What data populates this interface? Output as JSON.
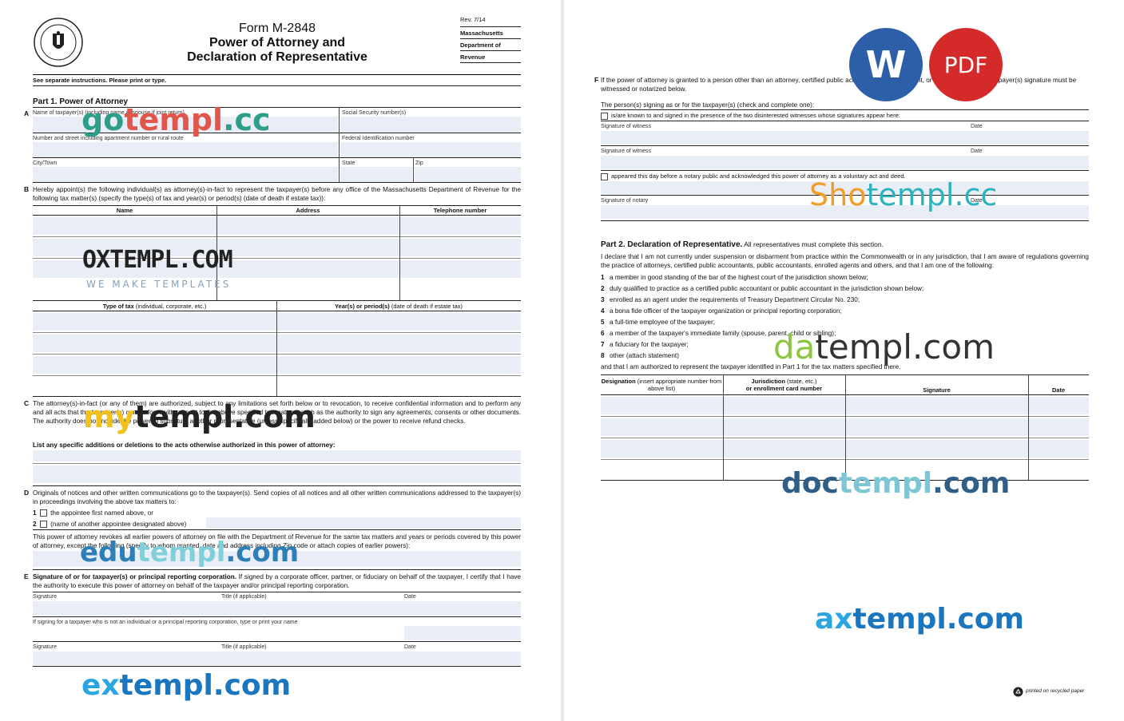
{
  "form": {
    "title_line1": "Form M-2848",
    "title_line2": "Power of Attorney and",
    "title_line3": "Declaration of Representative",
    "rev": "Rev. 7/14",
    "agency1": "Massachusetts",
    "agency2": "Department of",
    "agency3": "Revenue",
    "instructions": "See separate instructions. Please print or type.",
    "seal_text": "MASSACHUSETTS DEPARTMENT OF REVENUE"
  },
  "part1": {
    "title": "Part 1. Power of Attorney",
    "A": {
      "letter": "A",
      "name_label": "Name of taxpayer(s) (including name of spouse if joint return)",
      "ssn_label": "Social Security number(s)",
      "street_label": "Number and street including apartment number or rural route",
      "fid_label": "Federal Identification number",
      "city_label": "City/Town",
      "state_label": "State",
      "zip_label": "Zip"
    },
    "B": {
      "letter": "B",
      "text": "Hereby appoint(s) the following individual(s) as attorney(s)-in-fact to represent the taxpayer(s) before any office of the Massachusetts Department of Revenue for the following tax matter(s) (specify the type(s) of tax and year(s) or period(s) (date of death if estate tax)):",
      "col_name": "Name",
      "col_address": "Address",
      "col_phone": "Telephone number",
      "col_type_bold": "Type of tax",
      "col_type_rest": " (individual, corporate, etc.)",
      "col_year_bold": "Year(s) or period(s)",
      "col_year_rest": " (date of death if estate tax)"
    },
    "C": {
      "letter": "C",
      "text": "The attorney(s)-in-fact (or any of them) are authorized, subject to any limitations set forth below or to revocation, to receive confidential information and to perform any and all acts that the taxpayer(s) can perform with respect to the above specified tax matters, such as the authority to sign any agreements, consents or other documents. The authority does not include the power to substitute another representative (unless specifically added below) or the power to receive refund checks.",
      "list_label": "List any specific additions or deletions to the acts otherwise authorized in this power of attorney:"
    },
    "D": {
      "letter": "D",
      "text": "Originals of notices and other written communications go to the taxpayer(s). Send copies of all notices and all other written communications addressed to the taxpayer(s) in proceedings involving the above tax matters to:",
      "opt1_num": "1",
      "opt1": "the appointee first named above, or",
      "opt2_num": "2",
      "opt2": "(name of another appointee designated above)",
      "revoke_text": "This power of attorney revokes all earlier powers of attorney on file with the Department of Revenue for the same tax matters and years or periods covered by this power of attorney, except the following (specify to whom granted, date and address including Zip code or attach copies of earlier powers):"
    },
    "E": {
      "letter": "E",
      "title": "Signature of or for taxpayer(s) or principal reporting corporation.",
      "text": " If signed by a corporate officer, partner, or fiduciary on behalf of the taxpayer, I certify that I have the authority to execute this power of attorney on behalf of the taxpayer and/or principal reporting corporation.",
      "sig_label": "Signature",
      "title_label": "Title (if applicable)",
      "date_label": "Date",
      "other_label": "If signing for a taxpayer who is not an individual or a principal reporting corporation, type or print your name"
    }
  },
  "sectionF": {
    "letter": "F",
    "text": "If the power of attorney is granted to a person other than an attorney, certified public accountant, enrolled agent, or enrolled agent, the taxpayer(s) signature must be witnessed or notarized below.",
    "persons_label": "The person(s) signing as or for the taxpayer(s) (check and complete one):",
    "option1": "is/are known to and signed in the presence of the two disinterested witnesses whose signatures appear here:",
    "witness_label": "Signature of witness",
    "date_label": "Date",
    "option2": "appeared this day before a notary public and acknowledged this power of attorney as a voluntary act and deed.",
    "notary_label": "Signature of notary"
  },
  "part2": {
    "title": "Part 2. Declaration of Representative.",
    "title_rest": " All representatives must complete this section.",
    "intro": "I declare that I am not currently under suspension or disbarment from practice within the Commonwealth or in any jurisdiction, that I am aware of regulations governing the practice of attorneys, certified public accountants, public accountants, enrolled agents and others, and that I am one of the following:",
    "items": [
      {
        "num": "1",
        "text": "a member in good standing of the bar of the highest court of the jurisdiction shown below;"
      },
      {
        "num": "2",
        "text": "duly qualified to practice as a certified public accountant or public accountant in the jurisdiction shown below;"
      },
      {
        "num": "3",
        "text": "enrolled as an agent under the requirements of Treasury Department Circular No. 230;"
      },
      {
        "num": "4",
        "text": "a bona fide officer of the taxpayer organization or principal reporting corporation;"
      },
      {
        "num": "5",
        "text": "a full-time employee of the taxpayer;"
      },
      {
        "num": "6",
        "text": "a member of the taxpayer's immediate family (spouse, parent, child or sibling);"
      },
      {
        "num": "7",
        "text": "a fiduciary for the taxpayer;"
      },
      {
        "num": "8",
        "text": "other (attach statement)"
      }
    ],
    "closing": "and that I am authorized to represent the taxpayer identified in Part 1 for the tax matters specified there.",
    "col_designation_bold": "Designation",
    "col_designation_rest": " (insert appropriate number from above list)",
    "col_jurisdiction_bold": "Jurisdiction",
    "col_jurisdiction_rest": " (state, etc.)",
    "col_jurisdiction_line2": "or enrollment card number",
    "col_signature": "Signature",
    "col_date": "Date"
  },
  "footer": {
    "recycled": "printed on recycled paper"
  },
  "badges": {
    "word": "W",
    "pdf": "PDF",
    "word_color": "#2d5fa8",
    "pdf_color": "#d42a2a"
  },
  "watermarks": {
    "gotempl_a": "go",
    "gotempl_b": "templ",
    "gotempl_c": ".cc",
    "oxtempl": "OXTEMPL.COM",
    "oxtempl_sub": "WE MAKE TEMPLATES",
    "mytempl_a": "my",
    "mytempl_b": "templ.com",
    "edutempl_a": "edu",
    "edutempl_b": "templ",
    "edutempl_c": ".com",
    "extempl_a": "ex",
    "extempl_b": "templ.com",
    "shotempl_a": "Sho",
    "shotempl_b": "templ.cc",
    "datempl_a": "da",
    "datempl_b": "templ.com",
    "doctempl_a": "doc",
    "doctempl_b": "templ",
    "doctempl_c": ".com",
    "axtempl_a": "ax",
    "axtempl_b": "templ.com"
  }
}
